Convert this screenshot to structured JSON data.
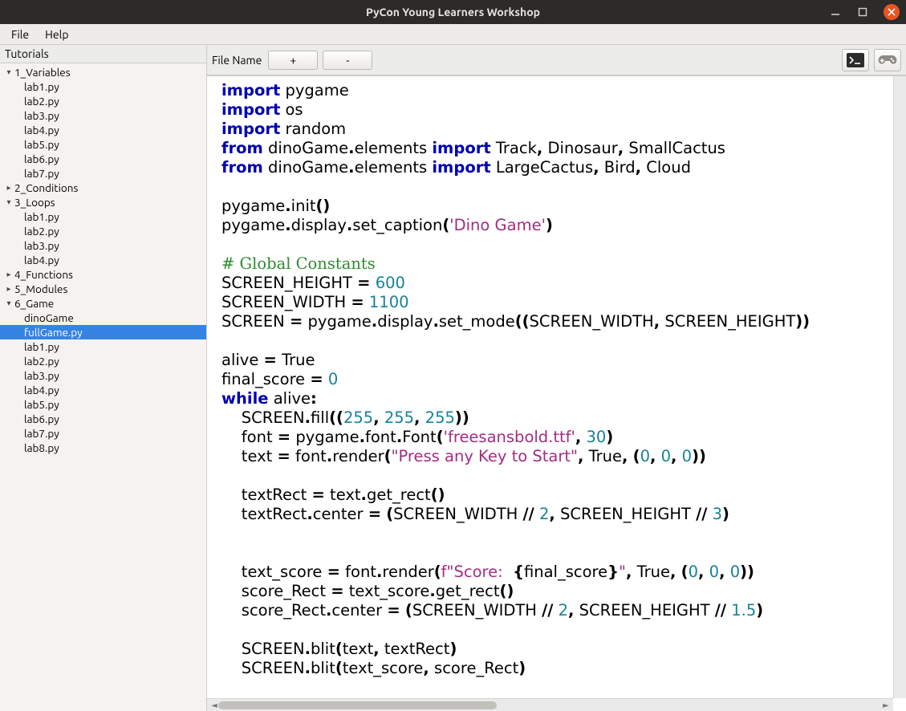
{
  "title": "PyCon Young Learners Workshop",
  "menubar": {
    "file": "File",
    "help": "Help"
  },
  "sidebar": {
    "header": "Tutorials",
    "tree": [
      {
        "label": "1_Variables",
        "type": "folder",
        "state": "open",
        "children": [
          "lab1.py",
          "lab2.py",
          "lab3.py",
          "lab4.py",
          "lab5.py",
          "lab6.py",
          "lab7.py"
        ]
      },
      {
        "label": "2_Conditions",
        "type": "folder",
        "state": "closed"
      },
      {
        "label": "3_Loops",
        "type": "folder",
        "state": "open",
        "children": [
          "lab1.py",
          "lab2.py",
          "lab3.py",
          "lab4.py"
        ]
      },
      {
        "label": "4_Functions",
        "type": "folder",
        "state": "closed"
      },
      {
        "label": "5_Modules",
        "type": "folder",
        "state": "closed"
      },
      {
        "label": "6_Game",
        "type": "folder",
        "state": "open",
        "children": [
          "dinoGame",
          "fullGame.py",
          "lab1.py",
          "lab2.py",
          "lab3.py",
          "lab4.py",
          "lab5.py",
          "lab6.py",
          "lab7.py",
          "lab8.py"
        ]
      }
    ],
    "selected": "fullGame.py"
  },
  "toolbar": {
    "file_name_label": "File Name",
    "plus": "+",
    "minus": "-",
    "run_icon": "terminal-icon",
    "game_icon": "gamepad-icon"
  },
  "editor": {
    "tokens": [
      [
        {
          "t": "import",
          "c": "kw"
        },
        {
          "t": " pygame"
        }
      ],
      [
        {
          "t": "import",
          "c": "kw"
        },
        {
          "t": " os"
        }
      ],
      [
        {
          "t": "import",
          "c": "kw"
        },
        {
          "t": " random"
        }
      ],
      [
        {
          "t": "from",
          "c": "kw"
        },
        {
          "t": " dinoGame"
        },
        {
          "t": ".",
          "c": "b"
        },
        {
          "t": "elements "
        },
        {
          "t": "import",
          "c": "kw"
        },
        {
          "t": " Track"
        },
        {
          "t": ",",
          "c": "b"
        },
        {
          "t": " Dinosaur"
        },
        {
          "t": ",",
          "c": "b"
        },
        {
          "t": " SmallCactus"
        }
      ],
      [
        {
          "t": "from",
          "c": "kw"
        },
        {
          "t": " dinoGame"
        },
        {
          "t": ".",
          "c": "b"
        },
        {
          "t": "elements "
        },
        {
          "t": "import",
          "c": "kw"
        },
        {
          "t": " LargeCactus"
        },
        {
          "t": ",",
          "c": "b"
        },
        {
          "t": " Bird"
        },
        {
          "t": ",",
          "c": "b"
        },
        {
          "t": " Cloud"
        }
      ],
      [],
      [
        {
          "t": "pygame"
        },
        {
          "t": ".",
          "c": "b"
        },
        {
          "t": "init"
        },
        {
          "t": "()",
          "c": "b"
        }
      ],
      [
        {
          "t": "pygame"
        },
        {
          "t": ".",
          "c": "b"
        },
        {
          "t": "display"
        },
        {
          "t": ".",
          "c": "b"
        },
        {
          "t": "set_caption"
        },
        {
          "t": "(",
          "c": "b"
        },
        {
          "t": "'Dino Game'",
          "c": "str"
        },
        {
          "t": ")",
          "c": "b"
        }
      ],
      [],
      [
        {
          "t": "# Global Constants",
          "c": "cm"
        }
      ],
      [
        {
          "t": "SCREEN_HEIGHT "
        },
        {
          "t": "=",
          "c": "b"
        },
        {
          "t": " "
        },
        {
          "t": "600",
          "c": "num"
        }
      ],
      [
        {
          "t": "SCREEN_WIDTH "
        },
        {
          "t": "=",
          "c": "b"
        },
        {
          "t": " "
        },
        {
          "t": "1100",
          "c": "num"
        }
      ],
      [
        {
          "t": "SCREEN "
        },
        {
          "t": "=",
          "c": "b"
        },
        {
          "t": " pygame"
        },
        {
          "t": ".",
          "c": "b"
        },
        {
          "t": "display"
        },
        {
          "t": ".",
          "c": "b"
        },
        {
          "t": "set_mode"
        },
        {
          "t": "((",
          "c": "b"
        },
        {
          "t": "SCREEN_WIDTH"
        },
        {
          "t": ",",
          "c": "b"
        },
        {
          "t": " SCREEN_HEIGHT"
        },
        {
          "t": "))",
          "c": "b"
        }
      ],
      [],
      [
        {
          "t": "alive "
        },
        {
          "t": "=",
          "c": "b"
        },
        {
          "t": " True"
        }
      ],
      [
        {
          "t": "final_score "
        },
        {
          "t": "=",
          "c": "b"
        },
        {
          "t": " "
        },
        {
          "t": "0",
          "c": "num"
        }
      ],
      [
        {
          "t": "while",
          "c": "kw"
        },
        {
          "t": " alive"
        },
        {
          "t": ":",
          "c": "b"
        }
      ],
      [
        {
          "t": "    SCREEN"
        },
        {
          "t": ".",
          "c": "b"
        },
        {
          "t": "fill"
        },
        {
          "t": "((",
          "c": "b"
        },
        {
          "t": "255",
          "c": "num"
        },
        {
          "t": ",",
          "c": "b"
        },
        {
          "t": " "
        },
        {
          "t": "255",
          "c": "num"
        },
        {
          "t": ",",
          "c": "b"
        },
        {
          "t": " "
        },
        {
          "t": "255",
          "c": "num"
        },
        {
          "t": "))",
          "c": "b"
        }
      ],
      [
        {
          "t": "    font "
        },
        {
          "t": "=",
          "c": "b"
        },
        {
          "t": " pygame"
        },
        {
          "t": ".",
          "c": "b"
        },
        {
          "t": "font"
        },
        {
          "t": ".",
          "c": "b"
        },
        {
          "t": "Font"
        },
        {
          "t": "(",
          "c": "b"
        },
        {
          "t": "'freesansbold.ttf'",
          "c": "str"
        },
        {
          "t": ",",
          "c": "b"
        },
        {
          "t": " "
        },
        {
          "t": "30",
          "c": "num"
        },
        {
          "t": ")",
          "c": "b"
        }
      ],
      [
        {
          "t": "    text "
        },
        {
          "t": "=",
          "c": "b"
        },
        {
          "t": " font"
        },
        {
          "t": ".",
          "c": "b"
        },
        {
          "t": "render"
        },
        {
          "t": "(",
          "c": "b"
        },
        {
          "t": "\"Press any Key to Start\"",
          "c": "str"
        },
        {
          "t": ",",
          "c": "b"
        },
        {
          "t": " True"
        },
        {
          "t": ",",
          "c": "b"
        },
        {
          "t": " "
        },
        {
          "t": "(",
          "c": "b"
        },
        {
          "t": "0",
          "c": "num"
        },
        {
          "t": ",",
          "c": "b"
        },
        {
          "t": " "
        },
        {
          "t": "0",
          "c": "num"
        },
        {
          "t": ",",
          "c": "b"
        },
        {
          "t": " "
        },
        {
          "t": "0",
          "c": "num"
        },
        {
          "t": "))",
          "c": "b"
        }
      ],
      [],
      [
        {
          "t": "    textRect "
        },
        {
          "t": "=",
          "c": "b"
        },
        {
          "t": " text"
        },
        {
          "t": ".",
          "c": "b"
        },
        {
          "t": "get_rect"
        },
        {
          "t": "()",
          "c": "b"
        }
      ],
      [
        {
          "t": "    textRect"
        },
        {
          "t": ".",
          "c": "b"
        },
        {
          "t": "center "
        },
        {
          "t": "=",
          "c": "b"
        },
        {
          "t": " "
        },
        {
          "t": "(",
          "c": "b"
        },
        {
          "t": "SCREEN_WIDTH "
        },
        {
          "t": "//",
          "c": "b"
        },
        {
          "t": " "
        },
        {
          "t": "2",
          "c": "num"
        },
        {
          "t": ",",
          "c": "b"
        },
        {
          "t": " SCREEN_HEIGHT "
        },
        {
          "t": "//",
          "c": "b"
        },
        {
          "t": " "
        },
        {
          "t": "3",
          "c": "num"
        },
        {
          "t": ")",
          "c": "b"
        }
      ],
      [],
      [],
      [
        {
          "t": "    text_score "
        },
        {
          "t": "=",
          "c": "b"
        },
        {
          "t": " font"
        },
        {
          "t": ".",
          "c": "b"
        },
        {
          "t": "render"
        },
        {
          "t": "(",
          "c": "b"
        },
        {
          "t": "f\"Score:  ",
          "c": "str"
        },
        {
          "t": "{",
          "c": "b"
        },
        {
          "t": "final_score"
        },
        {
          "t": "}",
          "c": "b"
        },
        {
          "t": "\"",
          "c": "str"
        },
        {
          "t": ",",
          "c": "b"
        },
        {
          "t": " True"
        },
        {
          "t": ",",
          "c": "b"
        },
        {
          "t": " "
        },
        {
          "t": "(",
          "c": "b"
        },
        {
          "t": "0",
          "c": "num"
        },
        {
          "t": ",",
          "c": "b"
        },
        {
          "t": " "
        },
        {
          "t": "0",
          "c": "num"
        },
        {
          "t": ",",
          "c": "b"
        },
        {
          "t": " "
        },
        {
          "t": "0",
          "c": "num"
        },
        {
          "t": "))",
          "c": "b"
        }
      ],
      [
        {
          "t": "    score_Rect "
        },
        {
          "t": "=",
          "c": "b"
        },
        {
          "t": " text_score"
        },
        {
          "t": ".",
          "c": "b"
        },
        {
          "t": "get_rect"
        },
        {
          "t": "()",
          "c": "b"
        }
      ],
      [
        {
          "t": "    score_Rect"
        },
        {
          "t": ".",
          "c": "b"
        },
        {
          "t": "center "
        },
        {
          "t": "=",
          "c": "b"
        },
        {
          "t": " "
        },
        {
          "t": "(",
          "c": "b"
        },
        {
          "t": "SCREEN_WIDTH "
        },
        {
          "t": "//",
          "c": "b"
        },
        {
          "t": " "
        },
        {
          "t": "2",
          "c": "num"
        },
        {
          "t": ",",
          "c": "b"
        },
        {
          "t": " SCREEN_HEIGHT "
        },
        {
          "t": "//",
          "c": "b"
        },
        {
          "t": " "
        },
        {
          "t": "1.5",
          "c": "num"
        },
        {
          "t": ")",
          "c": "b"
        }
      ],
      [],
      [
        {
          "t": "    SCREEN"
        },
        {
          "t": ".",
          "c": "b"
        },
        {
          "t": "blit"
        },
        {
          "t": "(",
          "c": "b"
        },
        {
          "t": "text"
        },
        {
          "t": ",",
          "c": "b"
        },
        {
          "t": " textRect"
        },
        {
          "t": ")",
          "c": "b"
        }
      ],
      [
        {
          "t": "    SCREEN"
        },
        {
          "t": ".",
          "c": "b"
        },
        {
          "t": "blit"
        },
        {
          "t": "(",
          "c": "b"
        },
        {
          "t": "text_score"
        },
        {
          "t": ",",
          "c": "b"
        },
        {
          "t": " score_Rect"
        },
        {
          "t": ")",
          "c": "b"
        }
      ]
    ]
  }
}
